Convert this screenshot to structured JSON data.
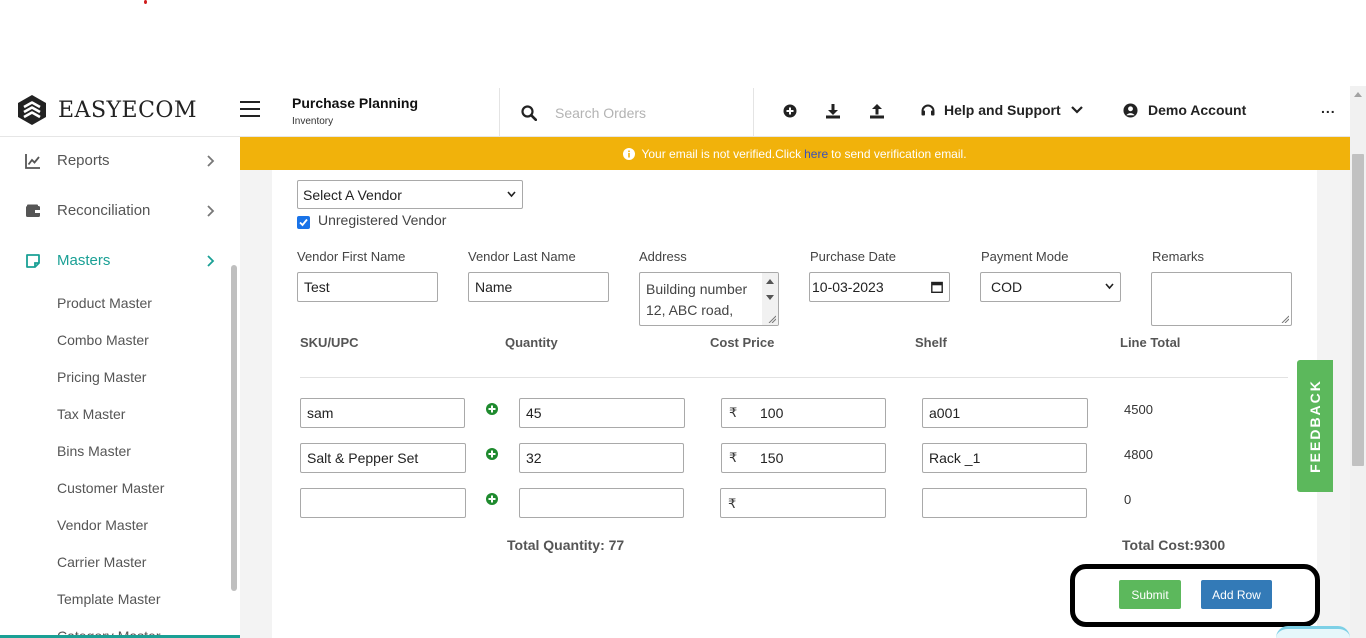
{
  "app": {
    "brand": "EASYECOM"
  },
  "header": {
    "title": "Purchase Planning",
    "subtitle": "Inventory",
    "search_placeholder": "Search Orders",
    "help_label": "Help and Support",
    "account_label": "Demo Account",
    "more_label": "..."
  },
  "sidebar": {
    "items": [
      {
        "label": "Reports"
      },
      {
        "label": "Reconciliation"
      },
      {
        "label": "Masters"
      }
    ],
    "subitems": [
      "Product Master",
      "Combo Master",
      "Pricing Master",
      "Tax Master",
      "Bins Master",
      "Customer Master",
      "Vendor Master",
      "Carrier Master",
      "Template Master",
      "Category Master"
    ],
    "accent_color": "#1aa095"
  },
  "banner": {
    "text_before": "Your email is not verified.Click",
    "link": "here",
    "text_after": "to send verification email.",
    "color": "#f1b20b"
  },
  "form": {
    "vendor_select": "Select A Vendor",
    "unregistered_label": "Unregistered Vendor",
    "unregistered_checked": true,
    "labels": {
      "first_name": "Vendor First Name",
      "last_name": "Vendor Last Name",
      "address": "Address",
      "purchase_date": "Purchase Date",
      "payment_mode": "Payment Mode",
      "remarks": "Remarks"
    },
    "values": {
      "first_name": "Test",
      "last_name": "Name",
      "address": "Building number 12, ABC road,",
      "purchase_date": "10-03-2023",
      "payment_mode": "COD",
      "remarks": ""
    }
  },
  "table": {
    "columns": [
      "SKU/UPC",
      "Quantity",
      "Cost Price",
      "Shelf",
      "Line Total"
    ],
    "currency": "₹",
    "rows": [
      {
        "sku": "sam",
        "qty": "45",
        "cost": "100",
        "shelf": "a001",
        "line_total": "4500"
      },
      {
        "sku": "Salt & Pepper Set",
        "qty": "32",
        "cost": "150",
        "shelf": "Rack _1",
        "line_total": "4800"
      },
      {
        "sku": "",
        "qty": "",
        "cost": "",
        "shelf": "",
        "line_total": "0"
      }
    ],
    "total_quantity": "Total Quantity: 77",
    "total_cost": "Total Cost:9300"
  },
  "actions": {
    "submit_label": "Submit",
    "add_row_label": "Add Row",
    "submit_color": "#5cb85c",
    "add_row_color": "#337ab7"
  },
  "feedback": {
    "label": "FEEDBACK",
    "color": "#5cb85c"
  }
}
